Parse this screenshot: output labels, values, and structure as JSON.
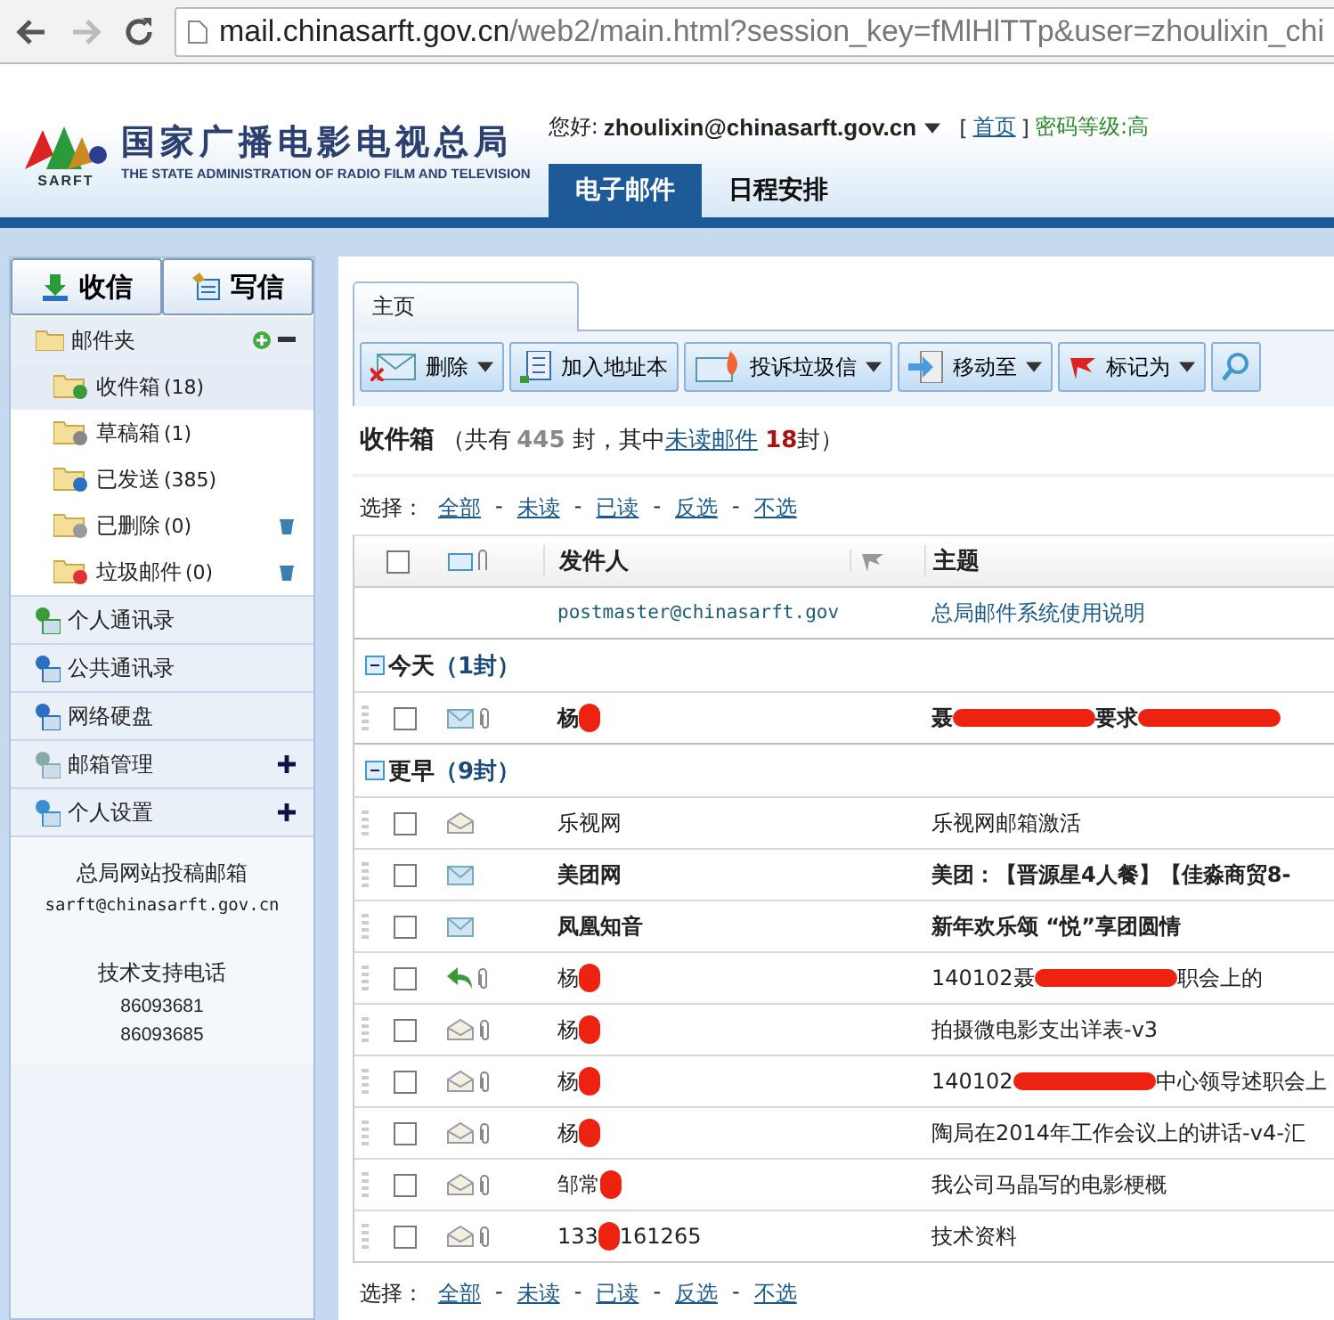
{
  "browser": {
    "back_disabled": false,
    "forward_disabled": true,
    "url_host": "mail.chinasarft.gov.cn",
    "url_rest": "/web2/main.html?session_key=fMlHlTTp&user=zhoulixin_chi"
  },
  "header": {
    "logo_mark": "SARFT",
    "org_name": "国家广播电影电视总局",
    "org_name_en": "THE STATE ADMINISTRATION OF RADIO FILM AND TELEVISION",
    "greeting": "您好:",
    "user": "zhoulixin@chinasarft.gov.cn",
    "bracket_open": "[",
    "home_link": "首页",
    "bracket_close": "]",
    "password_level": "密码等级:高",
    "tabs": [
      {
        "label": "电子邮件",
        "selected": true
      },
      {
        "label": "日程安排",
        "selected": false
      }
    ]
  },
  "sidebar": {
    "receive_button": "收信",
    "compose_button": "写信",
    "folder_header": "邮件夹",
    "folders": [
      {
        "name": "收件箱",
        "count": "(18)",
        "selected": true,
        "kind": "inbox",
        "trash": false
      },
      {
        "name": "草稿箱",
        "count": "(1)",
        "selected": false,
        "kind": "drafts",
        "trash": false
      },
      {
        "name": "已发送",
        "count": "(385)",
        "selected": false,
        "kind": "sent",
        "trash": false
      },
      {
        "name": "已删除",
        "count": "(0)",
        "selected": false,
        "kind": "deleted",
        "trash": true
      },
      {
        "name": "垃圾邮件",
        "count": "(0)",
        "selected": false,
        "kind": "spam",
        "trash": true
      }
    ],
    "sections": [
      {
        "label": "个人通讯录",
        "kind": "contacts",
        "expandable": false
      },
      {
        "label": "公共通讯录",
        "kind": "public-contacts",
        "expandable": false
      },
      {
        "label": "网络硬盘",
        "kind": "disk",
        "expandable": false
      },
      {
        "label": "邮箱管理",
        "kind": "wrench",
        "expandable": true
      },
      {
        "label": "个人设置",
        "kind": "gear",
        "expandable": true
      }
    ],
    "footer": {
      "mailbox_title": "总局网站投稿邮箱",
      "mailbox": "sarft@chinasarft.gov.cn",
      "phone_title": "技术支持电话",
      "phones": [
        "86093681",
        "86093685"
      ]
    }
  },
  "main": {
    "tab": "主页",
    "toolbar": [
      {
        "label": "删除",
        "kind": "delete",
        "dropdown": true
      },
      {
        "label": "加入地址本",
        "kind": "address",
        "dropdown": false
      },
      {
        "label": "投诉垃圾信",
        "kind": "spam",
        "dropdown": true
      },
      {
        "label": "移动至",
        "kind": "move",
        "dropdown": true
      },
      {
        "label": "标记为",
        "kind": "flag",
        "dropdown": true
      },
      {
        "kind": "search",
        "dropdown": false
      }
    ],
    "summary": {
      "folder": "收件箱",
      "prefix": "（共有",
      "total": "445",
      "middle": "封，其中",
      "unread_link": "未读邮件",
      "unread": "18",
      "suffix": "封）"
    },
    "select_top": {
      "label": "选择：",
      "links": [
        "全部",
        "未读",
        "已读",
        "反选",
        "不选"
      ],
      "separators": [
        "-",
        "-",
        "-",
        "-"
      ]
    },
    "table": {
      "columns": [
        {
          "label": "发件人"
        },
        {
          "label": "主题"
        }
      ],
      "header_checked": false,
      "pinned": {
        "sender": "postmaster@chinasarft.gov",
        "subject": "总局邮件系统使用说明"
      },
      "groups": [
        {
          "label": "今天",
          "count": "（1封）",
          "expanded": true,
          "rows": [
            {
              "kind": "unread",
              "checked": false,
              "attachment": true,
              "sender": [
                {
                  "text": "杨"
                },
                {
                  "kind": "redaction"
                }
              ],
              "subject": [
                {
                  "text": "聂"
                },
                {
                  "kind": "redaction"
                },
                {
                  "text": "要求"
                },
                {
                  "kind": "redaction"
                }
              ]
            }
          ]
        },
        {
          "label": "更早",
          "count": "（9封）",
          "expanded": true,
          "rows": [
            {
              "kind": "read",
              "checked": false,
              "attachment": false,
              "sender": [
                {
                  "text": "乐视网"
                }
              ],
              "subject": [
                {
                  "text": "乐视网邮箱激活"
                }
              ]
            },
            {
              "kind": "unread",
              "checked": false,
              "attachment": false,
              "sender": [
                {
                  "text": "美团网"
                }
              ],
              "subject": [
                {
                  "text": "美团：【晋源星4人餐】【佳淼商贸8-"
                }
              ]
            },
            {
              "kind": "unread",
              "checked": false,
              "attachment": false,
              "sender": [
                {
                  "text": "凤凰知音"
                }
              ],
              "subject": [
                {
                  "text": "新年欢乐颂 “悦”享团圆情"
                }
              ]
            },
            {
              "kind": "replied",
              "checked": false,
              "attachment": true,
              "sender": [
                {
                  "text": "杨"
                },
                {
                  "kind": "redaction"
                }
              ],
              "subject": [
                {
                  "text": "140102聂"
                },
                {
                  "kind": "redaction"
                },
                {
                  "text": "职会上的"
                }
              ]
            },
            {
              "kind": "read",
              "checked": false,
              "attachment": true,
              "sender": [
                {
                  "text": "杨"
                },
                {
                  "kind": "redaction"
                }
              ],
              "subject": [
                {
                  "text": "拍摄微电影支出详表-v3"
                }
              ]
            },
            {
              "kind": "read",
              "checked": false,
              "attachment": true,
              "sender": [
                {
                  "text": "杨"
                },
                {
                  "kind": "redaction"
                }
              ],
              "subject": [
                {
                  "text": "140102"
                },
                {
                  "kind": "redaction"
                },
                {
                  "text": "中心领导述职会上"
                }
              ]
            },
            {
              "kind": "read",
              "checked": false,
              "attachment": true,
              "sender": [
                {
                  "text": "杨"
                },
                {
                  "kind": "redaction"
                }
              ],
              "subject": [
                {
                  "text": "陶局在2014年工作会议上的讲话-v4-汇"
                }
              ]
            },
            {
              "kind": "read",
              "checked": false,
              "attachment": true,
              "sender": [
                {
                  "text": "邹常"
                },
                {
                  "kind": "redaction"
                }
              ],
              "subject": [
                {
                  "text": "我公司马晶写的电影梗概"
                }
              ]
            },
            {
              "kind": "read",
              "checked": false,
              "attachment": true,
              "sender": [
                {
                  "text": "133"
                },
                {
                  "kind": "redaction"
                },
                {
                  "text": "161265"
                }
              ],
              "subject": [
                {
                  "text": "技术资料"
                }
              ]
            }
          ]
        }
      ]
    },
    "select_bottom": {
      "label": "选择：",
      "links": [
        "全部",
        "未读",
        "已读",
        "反选",
        "不选"
      ],
      "separators": [
        "-",
        "-",
        "-",
        "-"
      ]
    }
  }
}
